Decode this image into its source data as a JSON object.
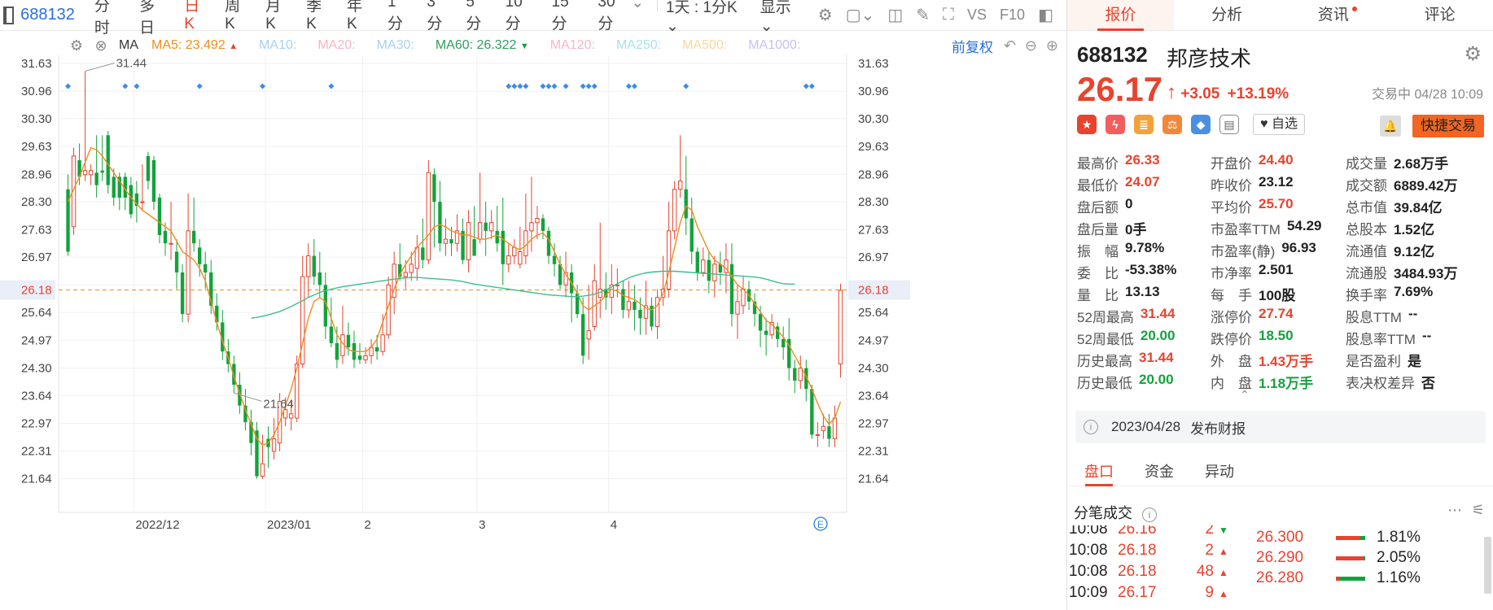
{
  "toolbar": {
    "code": "688132",
    "timeframes": [
      "分时",
      "多日",
      "日K",
      "周K",
      "月K",
      "季K",
      "年K",
      "1分",
      "3分",
      "5分",
      "10分",
      "15分",
      "30分"
    ],
    "active_timeframe": "日K",
    "range_select": "1天 : 1分K",
    "display_select": "显示",
    "vs_label": "VS",
    "f10_label": "F10"
  },
  "ma_bar": {
    "ma_label": "MA",
    "ma5": "MA5:  23.492",
    "ma10": "MA10:",
    "ma20": "MA20:",
    "ma30": "MA30:",
    "ma60": "MA60:  26.322",
    "ma120": "MA120:",
    "ma250": "MA250:",
    "ma500": "MA500:",
    "ma1000": "MA1000:",
    "adjust": "前复权"
  },
  "colors": {
    "up": "#e8432e",
    "down": "#12a33b",
    "ma5": "#f08c1e",
    "ma60": "#3cbf8c",
    "accent": "#2b6fd6",
    "ma10_muted": "#a8d0f0",
    "ma20_muted": "#f4b6c6",
    "ma30_muted": "#a8d0f0",
    "ma120_muted": "#f4b6c6",
    "ma250_muted": "#a8e0e8",
    "ma500_muted": "#f8d6a0",
    "ma1000_muted": "#c8c0f0"
  },
  "chart_data": {
    "type": "candlestick",
    "title": "",
    "y_ticks": [
      "31.63",
      "30.96",
      "30.30",
      "29.63",
      "28.96",
      "28.30",
      "27.63",
      "26.97",
      "26.30",
      "25.64",
      "24.97",
      "24.30",
      "23.64",
      "22.97",
      "22.31",
      "21.64"
    ],
    "ylim": [
      21.3,
      31.9
    ],
    "x_labels": [
      {
        "label": "2022/12",
        "index": 12
      },
      {
        "label": "2023/01",
        "index": 35
      },
      {
        "label": "2",
        "index": 52
      },
      {
        "label": "3",
        "index": 72
      },
      {
        "label": "4",
        "index": 95
      }
    ],
    "high_annotation": {
      "label": "31.44",
      "index": 3
    },
    "low_annotation": {
      "label": "21.64",
      "index": 29
    },
    "current_price_label": "26.18",
    "current_price": 26.18,
    "candles": [
      [
        28.6,
        27.1,
        28.96,
        27.0
      ],
      [
        27.7,
        29.4,
        29.6,
        27.5
      ],
      [
        29.3,
        28.9,
        29.7,
        28.7
      ],
      [
        28.95,
        29.05,
        31.44,
        28.8
      ],
      [
        28.95,
        29.05,
        29.2,
        28.7
      ],
      [
        29.0,
        28.7,
        29.9,
        28.4
      ],
      [
        29.05,
        29.0,
        29.9,
        28.8
      ],
      [
        29.9,
        28.7,
        30.0,
        28.5
      ],
      [
        28.9,
        28.4,
        29.1,
        28.2
      ],
      [
        28.9,
        28.4,
        29.0,
        28.1
      ],
      [
        28.9,
        28.4,
        29.0,
        28.1
      ],
      [
        28.7,
        28.0,
        28.9,
        27.9
      ],
      [
        28.5,
        28.2,
        28.8,
        27.8
      ],
      [
        28.3,
        28.3,
        29.2,
        28.1
      ],
      [
        29.4,
        28.8,
        29.5,
        28.6
      ],
      [
        29.3,
        28.3,
        29.4,
        28.1
      ],
      [
        28.4,
        27.5,
        28.5,
        27.3
      ],
      [
        27.6,
        27.3,
        27.8,
        27.0
      ],
      [
        27.3,
        27.3,
        28.3,
        26.9
      ],
      [
        27.1,
        26.6,
        27.4,
        26.2
      ],
      [
        26.6,
        25.6,
        26.8,
        25.4
      ],
      [
        25.6,
        27.6,
        28.5,
        25.4
      ],
      [
        27.6,
        27.3,
        28.4,
        27.1
      ],
      [
        27.2,
        26.8,
        27.4,
        26.5
      ],
      [
        26.8,
        26.6,
        27.1,
        26.2
      ],
      [
        26.6,
        25.8,
        26.9,
        25.6
      ],
      [
        25.8,
        25.4,
        26.1,
        25.2
      ],
      [
        25.4,
        24.7,
        25.7,
        24.5
      ],
      [
        24.7,
        24.4,
        25.0,
        24.2
      ],
      [
        24.4,
        23.9,
        24.6,
        23.7
      ],
      [
        23.9,
        23.4,
        24.2,
        23.2
      ],
      [
        23.4,
        23.0,
        23.8,
        22.8
      ],
      [
        23.0,
        22.5,
        23.3,
        22.2
      ],
      [
        22.8,
        21.7,
        23.0,
        21.64
      ],
      [
        21.7,
        22.0,
        22.7,
        21.64
      ],
      [
        22.6,
        22.4,
        22.9,
        21.9
      ],
      [
        22.3,
        22.6,
        23.1,
        22.1
      ],
      [
        22.5,
        23.5,
        23.7,
        22.3
      ],
      [
        23.1,
        23.3,
        23.6,
        22.9
      ],
      [
        23.1,
        23.2,
        23.5,
        22.8
      ],
      [
        23.1,
        24.4,
        24.6,
        23.0
      ],
      [
        24.4,
        26.5,
        27.0,
        24.3
      ],
      [
        26.5,
        27.0,
        27.3,
        26.0
      ],
      [
        27.0,
        26.5,
        27.4,
        26.3
      ],
      [
        26.6,
        26.3,
        27.1,
        26.0
      ],
      [
        26.3,
        25.3,
        26.6,
        25.0
      ],
      [
        25.3,
        24.9,
        26.0,
        24.8
      ],
      [
        24.9,
        24.5,
        25.3,
        24.3
      ],
      [
        24.6,
        25.1,
        25.8,
        24.4
      ],
      [
        25.1,
        24.8,
        25.4,
        24.6
      ],
      [
        24.9,
        24.5,
        25.2,
        24.3
      ],
      [
        24.6,
        24.5,
        24.9,
        24.4
      ],
      [
        24.5,
        24.6,
        24.8,
        24.4
      ],
      [
        24.6,
        24.8,
        25.0,
        24.4
      ],
      [
        24.8,
        24.7,
        25.1,
        24.5
      ],
      [
        24.7,
        25.1,
        25.6,
        24.6
      ],
      [
        25.1,
        26.3,
        26.5,
        25.0
      ],
      [
        26.0,
        26.8,
        27.1,
        25.6
      ],
      [
        26.8,
        26.5,
        27.3,
        26.4
      ],
      [
        26.5,
        26.6,
        26.9,
        26.2
      ],
      [
        26.6,
        26.8,
        27.1,
        26.4
      ],
      [
        26.7,
        27.2,
        27.5,
        26.4
      ],
      [
        27.2,
        26.9,
        27.9,
        26.7
      ],
      [
        26.9,
        29.0,
        29.3,
        26.8
      ],
      [
        28.96,
        28.3,
        29.1,
        27.2
      ],
      [
        28.3,
        27.3,
        28.8,
        27.1
      ],
      [
        27.3,
        27.4,
        27.9,
        27.0
      ],
      [
        27.4,
        27.3,
        27.7,
        27.0
      ],
      [
        27.3,
        27.6,
        28.0,
        27.1
      ],
      [
        27.6,
        26.9,
        27.9,
        26.8
      ],
      [
        26.9,
        27.8,
        28.1,
        26.6
      ],
      [
        27.4,
        27.0,
        28.2,
        27.1
      ],
      [
        27.4,
        27.8,
        29.0,
        27.3
      ],
      [
        27.8,
        27.6,
        28.3,
        27.0
      ],
      [
        27.6,
        27.8,
        28.1,
        27.4
      ],
      [
        27.6,
        27.3,
        28.2,
        27.1
      ],
      [
        27.6,
        26.8,
        28.4,
        26.3
      ],
      [
        26.8,
        27.0,
        27.3,
        26.6
      ],
      [
        27.0,
        27.2,
        27.4,
        26.8
      ],
      [
        26.8,
        27.1,
        27.7,
        26.7
      ],
      [
        27.0,
        27.6,
        28.5,
        26.8
      ],
      [
        27.6,
        27.8,
        28.9,
        27.1
      ],
      [
        27.8,
        27.9,
        28.2,
        27.4
      ],
      [
        27.9,
        27.6,
        28.0,
        27.4
      ],
      [
        27.6,
        27.0,
        27.7,
        26.8
      ],
      [
        27.0,
        26.8,
        27.3,
        26.5
      ],
      [
        26.8,
        26.3,
        27.0,
        26.2
      ],
      [
        26.3,
        26.6,
        27.1,
        26.0
      ],
      [
        26.6,
        26.1,
        26.8,
        25.4
      ],
      [
        26.1,
        25.6,
        26.3,
        25.5
      ],
      [
        25.6,
        24.6,
        26.0,
        24.4
      ],
      [
        25.0,
        25.2,
        26.3,
        24.5
      ],
      [
        25.3,
        26.4,
        26.8,
        25.2
      ],
      [
        26.0,
        26.2,
        27.8,
        25.5
      ],
      [
        26.2,
        26.0,
        26.6,
        25.7
      ],
      [
        26.0,
        26.3,
        26.8,
        25.6
      ],
      [
        26.3,
        26.3,
        26.7,
        26.0
      ],
      [
        26.2,
        25.7,
        26.4,
        25.5
      ],
      [
        25.7,
        25.9,
        26.4,
        25.5
      ],
      [
        25.9,
        25.7,
        26.3,
        25.2
      ],
      [
        25.7,
        25.5,
        26.0,
        25.1
      ],
      [
        25.5,
        25.8,
        26.4,
        25.1
      ],
      [
        25.8,
        25.3,
        26.0,
        25.2
      ],
      [
        25.3,
        26.0,
        26.2,
        25.0
      ],
      [
        26.0,
        26.2,
        27.0,
        25.8
      ],
      [
        26.2,
        27.6,
        28.3,
        26.0
      ],
      [
        27.6,
        28.6,
        28.8,
        27.4
      ],
      [
        28.6,
        28.8,
        29.9,
        28.4
      ],
      [
        28.6,
        27.9,
        29.4,
        27.5
      ],
      [
        27.9,
        27.1,
        28.4,
        26.8
      ],
      [
        27.1,
        26.6,
        27.2,
        26.4
      ],
      [
        26.6,
        26.9,
        27.2,
        26.5
      ],
      [
        26.9,
        26.4,
        27.1,
        26.1
      ],
      [
        26.4,
        26.8,
        27.0,
        26.0
      ],
      [
        26.8,
        26.6,
        27.1,
        26.3
      ],
      [
        26.6,
        26.9,
        27.3,
        26.1
      ],
      [
        26.8,
        25.6,
        27.3,
        25.3
      ],
      [
        25.6,
        25.9,
        26.3,
        25.0
      ],
      [
        25.8,
        26.2,
        26.5,
        25.6
      ],
      [
        26.2,
        25.9,
        26.4,
        25.7
      ],
      [
        25.9,
        25.6,
        26.1,
        25.3
      ],
      [
        25.6,
        25.2,
        25.8,
        24.8
      ],
      [
        25.2,
        25.1,
        25.5,
        24.6
      ],
      [
        25.1,
        25.4,
        25.6,
        25.0
      ],
      [
        25.3,
        25.0,
        25.4,
        24.8
      ],
      [
        25.0,
        24.8,
        25.3,
        24.5
      ],
      [
        25.0,
        24.3,
        25.5,
        24.0
      ],
      [
        24.3,
        24.0,
        24.5,
        23.7
      ],
      [
        24.0,
        24.3,
        24.6,
        23.8
      ],
      [
        24.3,
        23.8,
        24.5,
        23.5
      ],
      [
        23.8,
        22.7,
        23.9,
        22.6
      ],
      [
        22.7,
        22.7,
        23.0,
        22.4
      ],
      [
        22.8,
        22.9,
        23.2,
        22.6
      ],
      [
        22.9,
        22.6,
        23.2,
        22.4
      ],
      [
        22.6,
        23.1,
        23.4,
        22.4
      ],
      [
        24.4,
        26.17,
        26.33,
        24.07
      ]
    ],
    "ma5": [
      28.3,
      28.6,
      28.9,
      29.25,
      29.6,
      29.55,
      29.4,
      29.2,
      29.0,
      28.8,
      28.6,
      28.4,
      28.25,
      28.1,
      28.0,
      27.9,
      27.8,
      27.7,
      27.6,
      27.35,
      27.1,
      27.0,
      26.9,
      26.7,
      26.4,
      25.9,
      25.4,
      24.95,
      24.55,
      24.1,
      23.7,
      23.3,
      22.95,
      22.6,
      22.45,
      22.5,
      22.7,
      23.0,
      23.4,
      23.8,
      24.3,
      24.9,
      25.5,
      25.9,
      26.0,
      25.9,
      25.5,
      25.1,
      24.9,
      24.75,
      24.7,
      24.7,
      24.7,
      24.8,
      25.0,
      25.4,
      25.8,
      26.2,
      26.55,
      26.8,
      27.0,
      27.2,
      27.35,
      27.5,
      27.7,
      27.75,
      27.7,
      27.6,
      27.55,
      27.5,
      27.5,
      27.45,
      27.4,
      27.4,
      27.45,
      27.5,
      27.4,
      27.3,
      27.2,
      27.15,
      27.25,
      27.4,
      27.5,
      27.55,
      27.4,
      27.1,
      26.8,
      26.55,
      26.35,
      26.1,
      25.8,
      25.7,
      25.8,
      25.9,
      26.05,
      26.2,
      26.15,
      26.05,
      26.0,
      25.95,
      25.85,
      25.75,
      25.7,
      25.8,
      26.1,
      26.6,
      27.2,
      27.8,
      28.2,
      28.1,
      27.7,
      27.4,
      27.1,
      26.9,
      26.8,
      26.7,
      26.5,
      26.3,
      26.2,
      26.05,
      25.85,
      25.65,
      25.45,
      25.35,
      25.2,
      25.05,
      24.85,
      24.6,
      24.35,
      24.1,
      23.8,
      23.45,
      23.15,
      22.95,
      23.1,
      23.49
    ],
    "ma60_start": 32,
    "ma60": [
      25.5,
      25.52,
      25.55,
      25.58,
      25.62,
      25.66,
      25.72,
      25.78,
      25.85,
      25.92,
      26.0,
      26.06,
      26.12,
      26.16,
      26.2,
      26.23,
      26.26,
      26.28,
      26.3,
      26.32,
      26.34,
      26.36,
      26.38,
      26.4,
      26.42,
      26.44,
      26.46,
      26.47,
      26.48,
      26.48,
      26.47,
      26.46,
      26.45,
      26.44,
      26.43,
      26.42,
      26.4,
      26.38,
      26.35,
      26.32,
      26.3,
      26.28,
      26.26,
      26.24,
      26.22,
      26.2,
      26.18,
      26.16,
      26.14,
      26.12,
      26.1,
      26.08,
      26.06,
      26.05,
      26.04,
      26.03,
      26.02,
      26.02,
      26.03,
      26.05,
      26.08,
      26.12,
      26.18,
      26.25,
      26.33,
      26.4,
      26.47,
      26.52,
      26.56,
      26.59,
      26.61,
      26.62,
      26.63,
      26.63,
      26.63,
      26.62,
      26.61,
      26.6,
      26.59,
      26.58,
      26.57,
      26.56,
      26.55,
      26.54,
      26.53,
      26.52,
      26.51,
      26.5,
      26.49,
      26.47,
      26.44,
      26.4,
      26.36,
      26.33,
      26.322,
      26.32
    ],
    "markers": [
      0,
      10,
      12,
      23,
      34,
      46,
      77,
      78,
      79,
      80,
      83,
      84,
      85,
      87,
      90,
      91,
      92,
      98,
      99,
      108,
      129,
      130
    ]
  },
  "right_panel": {
    "tabs": [
      "报价",
      "分析",
      "资讯",
      "评论"
    ],
    "active_tab": "报价",
    "code": "688132",
    "name": "邦彦技术",
    "price": "26.17",
    "change": "+3.05",
    "change_pct": "+13.19%",
    "status": "交易中 04/28 10:09",
    "watch": "自选",
    "trade": "快捷交易",
    "quote_rows": [
      [
        {
          "k": "最高价",
          "v": "26.33",
          "c": "red"
        },
        {
          "k": "开盘价",
          "v": "24.40",
          "c": "red"
        },
        {
          "k": "成交量",
          "v": "2.68万手",
          "c": "dark"
        }
      ],
      [
        {
          "k": "最低价",
          "v": "24.07",
          "c": "red"
        },
        {
          "k": "昨收价",
          "v": "23.12",
          "c": "dark"
        },
        {
          "k": "成交额",
          "v": "6889.42万",
          "c": "dark"
        }
      ],
      [
        {
          "k": "盘后额",
          "v": "0",
          "c": "dark"
        },
        {
          "k": "平均价",
          "v": "25.70",
          "c": "red"
        },
        {
          "k": "总市值",
          "v": "39.84亿",
          "c": "dark"
        }
      ],
      [
        {
          "k": "盘后量",
          "v": "0手",
          "c": "dark"
        },
        {
          "k": "市盈率TTM",
          "v": "54.29",
          "c": "dark"
        },
        {
          "k": "总股本",
          "v": "1.52亿",
          "c": "dark"
        }
      ],
      [
        {
          "k": "振　幅",
          "v": "9.78%",
          "c": "dark"
        },
        {
          "k": "市盈率(静)",
          "v": "96.93",
          "c": "dark"
        },
        {
          "k": "流通值",
          "v": "9.12亿",
          "c": "dark"
        }
      ],
      [
        {
          "k": "委　比",
          "v": "-53.38%",
          "c": "dark"
        },
        {
          "k": "市净率",
          "v": "2.501",
          "c": "dark"
        },
        {
          "k": "流通股",
          "v": "3484.93万",
          "c": "dark"
        }
      ],
      [
        {
          "k": "量　比",
          "v": "13.13",
          "c": "dark"
        },
        {
          "k": "每　手",
          "v": "100股",
          "c": "dark"
        },
        {
          "k": "换手率",
          "v": "7.69%",
          "c": "dark"
        }
      ],
      [
        {
          "k": "52周最高",
          "v": "31.44",
          "c": "red"
        },
        {
          "k": "涨停价",
          "v": "27.74",
          "c": "red"
        },
        {
          "k": "股息TTM",
          "v": "--",
          "c": "dark"
        }
      ],
      [
        {
          "k": "52周最低",
          "v": "20.00",
          "c": "green"
        },
        {
          "k": "跌停价",
          "v": "18.50",
          "c": "green"
        },
        {
          "k": "股息率TTM",
          "v": "--",
          "c": "dark"
        }
      ],
      [
        {
          "k": "历史最高",
          "v": "31.44",
          "c": "red"
        },
        {
          "k": "外　盘",
          "v": "1.43万手",
          "c": "red"
        },
        {
          "k": "是否盈利",
          "v": "是",
          "c": "dark"
        }
      ],
      [
        {
          "k": "历史最低",
          "v": "20.00",
          "c": "green"
        },
        {
          "k": "内　盘",
          "v": "1.18万手",
          "c": "green"
        },
        {
          "k": "表决权差异",
          "v": "否",
          "c": "dark"
        }
      ]
    ],
    "report_date": "2023/04/28",
    "report_text": "发布财报",
    "tabs2": [
      "盘口",
      "资金",
      "异动"
    ],
    "active_tab2": "盘口",
    "ticks_title": "分笔成交",
    "ticks": [
      {
        "time": "10:08",
        "price": "26.16",
        "vol": "2",
        "dir": "down"
      },
      {
        "time": "10:08",
        "price": "26.18",
        "vol": "2",
        "dir": "up"
      },
      {
        "time": "10:08",
        "price": "26.18",
        "vol": "48",
        "dir": "up"
      },
      {
        "time": "10:09",
        "price": "26.17",
        "vol": "9",
        "dir": "up"
      }
    ],
    "orderbook": [
      {
        "price": "26.300",
        "pct": "1.81%",
        "share": 0.82
      },
      {
        "price": "26.290",
        "pct": "2.05%",
        "share": 0.95
      },
      {
        "price": "26.280",
        "pct": "1.16%",
        "share": 0.15
      }
    ]
  }
}
